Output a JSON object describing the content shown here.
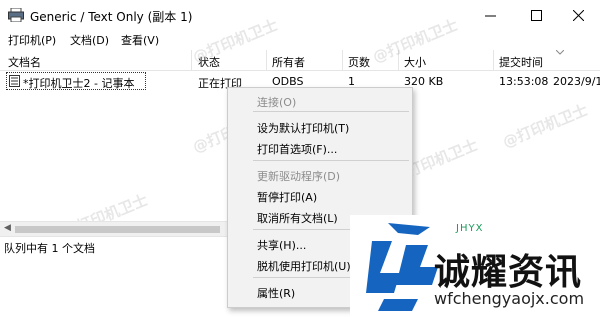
{
  "window": {
    "title": "Generic / Text Only (副本 1)"
  },
  "menu": [
    "打印机(P)",
    "文档(D)",
    "查看(V)"
  ],
  "columns": [
    "文档名",
    "状态",
    "所有者",
    "页数",
    "大小",
    "提交时间"
  ],
  "row": {
    "name": "*打印机卫士2 - 记事本",
    "status": "正在打印",
    "owner": "ODBS",
    "pages": "1",
    "size": "320 KB",
    "submitted_time": "13:53:08",
    "submitted_date": "2023/9/1"
  },
  "status_bar": "队列中有 1 个文档",
  "context_menu": [
    {
      "label": "连接(O)",
      "disabled": true
    },
    {
      "label": "设为默认打印机(T)",
      "disabled": false
    },
    {
      "label": "打印首选项(F)...",
      "disabled": false
    },
    {
      "label": "更新驱动程序(D)",
      "disabled": true
    },
    {
      "label": "暂停打印(A)",
      "disabled": false
    },
    {
      "label": "取消所有文档(L)",
      "disabled": false
    },
    {
      "label": "共享(H)...",
      "disabled": false
    },
    {
      "label": "脱机使用打印机(U)",
      "disabled": false
    },
    {
      "label": "属性(R)",
      "disabled": false
    }
  ],
  "watermark": "@打印机卫士",
  "logo": {
    "name": "诚耀资讯",
    "url": "wfchengyaojx.com",
    "top_text": "JHYX"
  },
  "colors": {
    "accent_blue": "#1565c0",
    "logo_green": "#1a9b5a",
    "menu_bg": "#f2f2f2"
  }
}
